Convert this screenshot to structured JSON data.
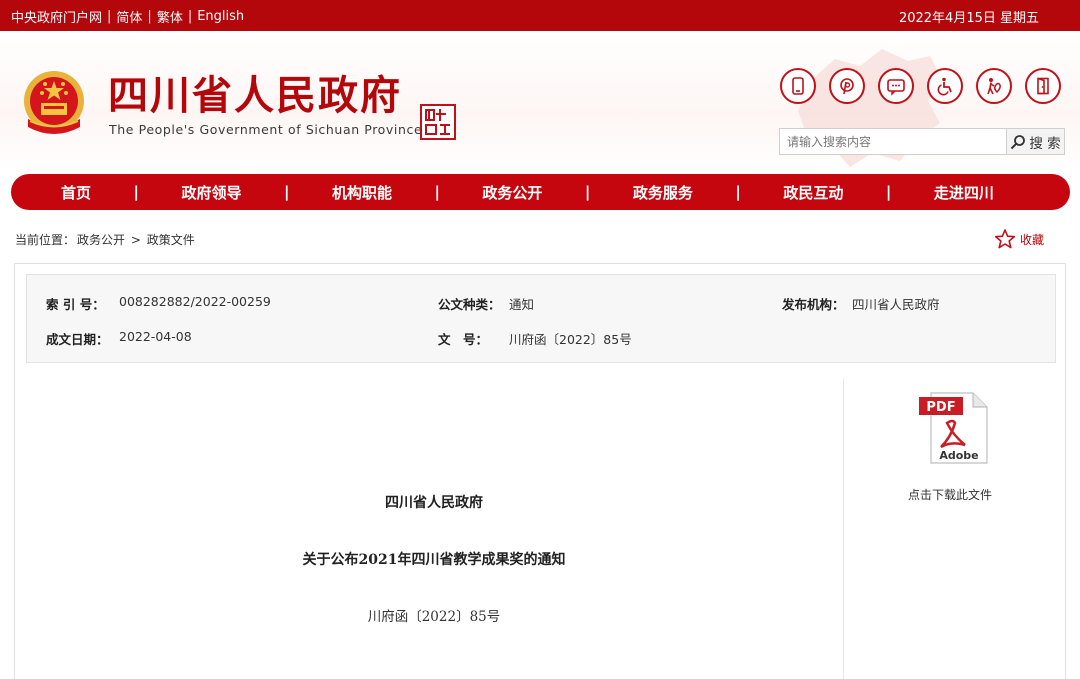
{
  "topbar": {
    "links": [
      "中央政府门户网",
      "简体",
      "繁体",
      "English"
    ],
    "date": "2022年4月15日 星期五"
  },
  "header": {
    "title": "四川省人民政府",
    "subtitle": "The People's Government of Sichuan Province",
    "icons": [
      "mobile-icon",
      "weibo-icon",
      "wechat-icon",
      "accessibility-icon",
      "elder-care-icon",
      "exit-icon"
    ],
    "search": {
      "placeholder": "请输入搜索内容",
      "button": "搜 索"
    }
  },
  "nav": {
    "items": [
      "首页",
      "政府领导",
      "机构职能",
      "政务公开",
      "政务服务",
      "政民互动",
      "走进四川"
    ],
    "separator": "|"
  },
  "breadcrumb": {
    "label": "当前位置：",
    "items": [
      "政务公开",
      "政策文件"
    ],
    "separator": ">"
  },
  "favorite": {
    "label": "收藏"
  },
  "meta": {
    "index_label": "索 引 号：",
    "index_value": "008282882/2022-00259",
    "type_label": "公文种类：",
    "type_value": "通知",
    "org_label": "发布机构：",
    "org_value": "四川省人民政府",
    "date_label": "成文日期：",
    "date_value": "2022-04-08",
    "docno_label": "文　号：",
    "docno_value": "川府函〔2022〕85号"
  },
  "download": {
    "pdf_label": "PDF",
    "brand": "Adobe",
    "caption": "点击下载此文件"
  },
  "document": {
    "org": "四川省人民政府",
    "title": "关于公布2021年四川省教学成果奖的通知",
    "number": "川府函〔2022〕85号"
  },
  "colors": {
    "brand": "#b3070b",
    "nav": "#c5060f"
  }
}
